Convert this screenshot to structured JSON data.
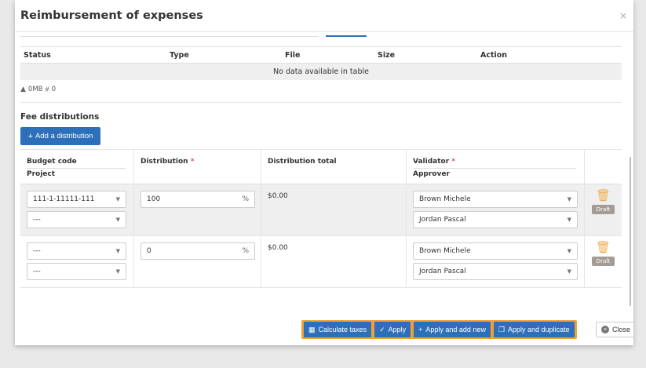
{
  "modal": {
    "title": "Reimbursement of expenses",
    "close_glyph": "×"
  },
  "files_table": {
    "headers": [
      "Status",
      "Type",
      "File",
      "Size",
      "Action"
    ],
    "empty_text": "No data available in table"
  },
  "file_footer": {
    "size": "0MB",
    "count": "0"
  },
  "distributions": {
    "title": "Fee distributions",
    "add_label": "Add a distribution",
    "headers": {
      "budget_code": "Budget code",
      "project": "Project",
      "distribution": "Distribution",
      "distribution_total": "Distribution total",
      "validator": "Validator",
      "approver": "Approver",
      "required_mark": "*"
    },
    "rows": [
      {
        "budget_code": "111-1-11111-111",
        "project": "---",
        "distribution": "100",
        "unit": "%",
        "total": "$0.00",
        "validator": "Brown Michele",
        "approver": "Jordan Pascal",
        "status": "Draft"
      },
      {
        "budget_code": "---",
        "project": "---",
        "distribution": "0",
        "unit": "%",
        "total": "$0.00",
        "validator": "Brown Michele",
        "approver": "Jordan Pascal",
        "status": "Draft"
      }
    ]
  },
  "footer": {
    "calculate_taxes": "Calculate taxes",
    "apply": "Apply",
    "apply_add_new": "Apply and add new",
    "apply_duplicate": "Apply and duplicate",
    "close": "Close"
  },
  "colors": {
    "primary": "#2b70b9",
    "highlight": "#f0a12f",
    "trash": "#f0ad4e",
    "draft_badge": "#a39b96",
    "required": "#d9534f"
  },
  "icons": [
    "close-icon",
    "weight-icon",
    "file-count-icon",
    "plus-icon",
    "chevron-down-icon",
    "trash-icon",
    "calculator-icon",
    "check-icon",
    "copy-icon",
    "close-circle-icon"
  ]
}
